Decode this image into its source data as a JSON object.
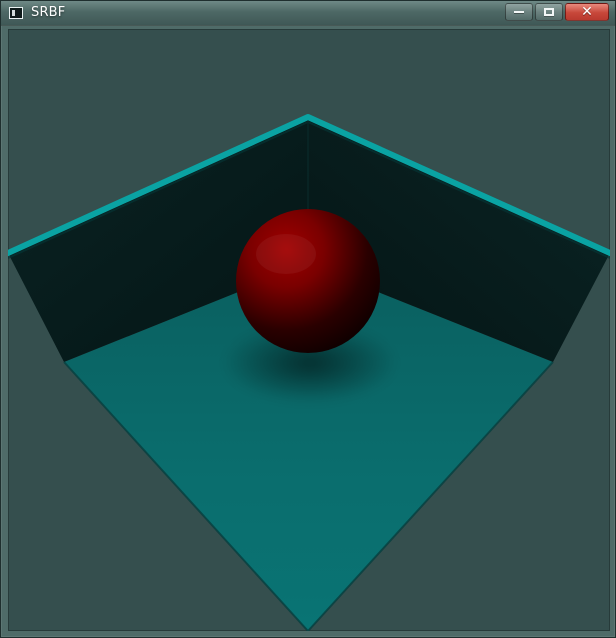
{
  "window": {
    "title": "SRBF",
    "controls": {
      "minimize": "minimize",
      "maximize": "maximize",
      "close": "close"
    }
  },
  "icons": {
    "app": "app-icon",
    "minimize": "minimize-icon",
    "maximize": "maximize-icon",
    "close": "close-icon"
  },
  "colors": {
    "background": "#354f4e",
    "floor_teal": "#0a6f6f",
    "wall_dark": "#071c1c",
    "edge_teal": "#0aa3a3",
    "sphere_red": "#8b0000"
  }
}
